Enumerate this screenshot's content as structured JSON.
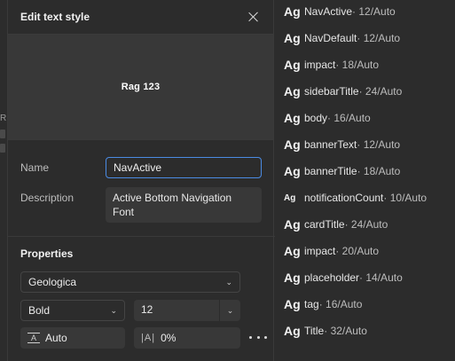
{
  "dialog": {
    "title": "Edit text style",
    "preview_text": "Rag 123",
    "name_label": "Name",
    "name_value": "NavActive",
    "description_label": "Description",
    "description_value": "Active Bottom Navigation Font",
    "properties_title": "Properties",
    "font_family": "Geologica",
    "font_weight": "Bold",
    "font_size": "12",
    "line_height": "Auto",
    "letter_spacing": "0%"
  },
  "edge_fragment": {
    "char": "R"
  },
  "styles": [
    {
      "glyph": "Ag",
      "glyph_size": "large",
      "name": "NavActive",
      "meta": " · 12/Auto"
    },
    {
      "glyph": "Ag",
      "glyph_size": "large",
      "name": "NavDefault",
      "meta": " · 12/Auto"
    },
    {
      "glyph": "Ag",
      "glyph_size": "large",
      "name": "impact",
      "meta": " · 18/Auto"
    },
    {
      "glyph": "Ag",
      "glyph_size": "large",
      "name": "sidebarTitle",
      "meta": " · 24/Auto"
    },
    {
      "glyph": "Ag",
      "glyph_size": "large",
      "name": "body",
      "meta": " · 16/Auto"
    },
    {
      "glyph": "Ag",
      "glyph_size": "large",
      "name": "bannerText",
      "meta": " · 12/Auto"
    },
    {
      "glyph": "Ag",
      "glyph_size": "large",
      "name": "bannerTitle",
      "meta": " · 18/Auto"
    },
    {
      "glyph": "Ag",
      "glyph_size": "small",
      "name": "notificationCount",
      "meta": " · 10/Auto"
    },
    {
      "glyph": "Ag",
      "glyph_size": "large",
      "name": "cardTitle",
      "meta": " · 24/Auto"
    },
    {
      "glyph": "Ag",
      "glyph_size": "large",
      "name": "impact",
      "meta": " · 20/Auto"
    },
    {
      "glyph": "Ag",
      "glyph_size": "large",
      "name": "placeholder",
      "meta": " · 14/Auto"
    },
    {
      "glyph": "Ag",
      "glyph_size": "large",
      "name": "tag",
      "meta": " · 16/Auto"
    },
    {
      "glyph": "Ag",
      "glyph_size": "large",
      "name": "Title",
      "meta": " · 32/Auto"
    }
  ],
  "colors": {
    "background": "#2c2c2c",
    "preview_bg": "#383838",
    "focus_border": "#4b8be3"
  }
}
